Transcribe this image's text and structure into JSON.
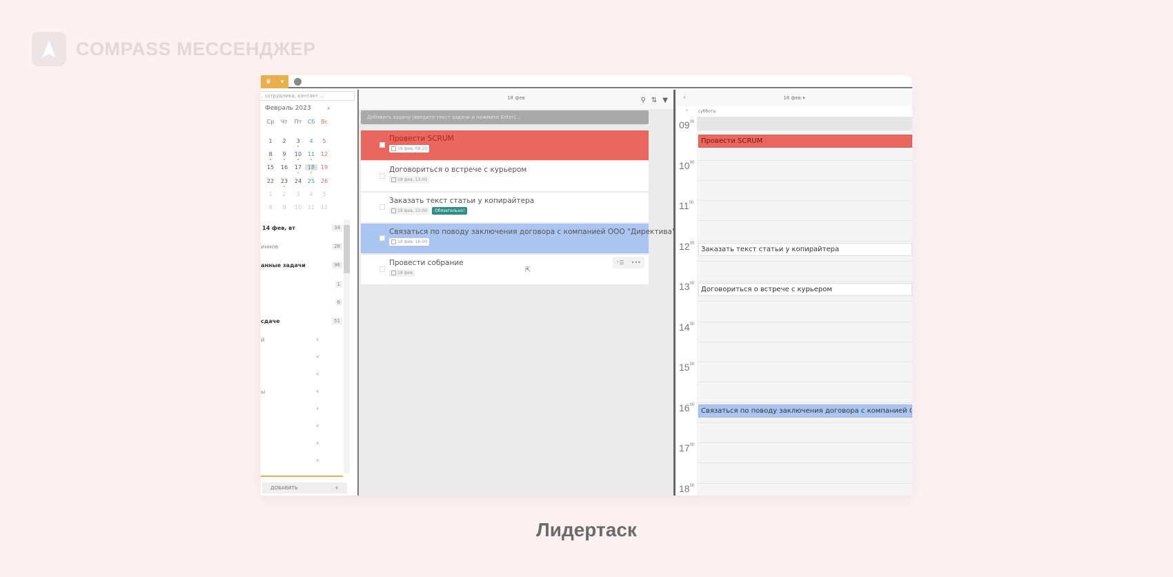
{
  "brand": {
    "name": "COMPASS МЕССЕНДЖЕР"
  },
  "caption": "Лидертаск",
  "sidebar": {
    "search_placeholder": ", сотрудника, контакт ...",
    "month": "Февраль 2023",
    "weekdays": [
      "Ср",
      "Чт",
      "Пт",
      "Сб",
      "Вс"
    ],
    "weeks": [
      [
        "1",
        "2",
        "3",
        "4",
        "5"
      ],
      [
        "8",
        "9",
        "10",
        "11",
        "12"
      ],
      [
        "15",
        "16",
        "17",
        "18",
        "19"
      ],
      [
        "22",
        "23",
        "24",
        "25",
        "26"
      ],
      [
        "1",
        "2",
        "3",
        "4",
        "5"
      ],
      [
        "8",
        "9",
        "10",
        "11",
        "12"
      ]
    ],
    "items": [
      {
        "label": "14 фев, вт",
        "count": "34"
      },
      {
        "label": "инное",
        "count": "28"
      },
      {
        "label": "анные задачи",
        "count": "96"
      },
      {
        "label": "",
        "count": "1"
      },
      {
        "label": "",
        "count": "6"
      },
      {
        "label": "сдаче",
        "count": "51"
      }
    ],
    "groups": [
      "й",
      "",
      "",
      "ы",
      "",
      "",
      "",
      ""
    ],
    "add_label": "ДОБАВИТЬ",
    "add_icon": "+"
  },
  "tasks": {
    "header": "18 фев",
    "add_placeholder": "Добавить задачу (введите текст задачи и нажмите Enter)...",
    "items": [
      {
        "title": "Провести SCRUM",
        "date": "18 фев, 09:20",
        "color": "#e9675f"
      },
      {
        "title": "Договориться о встрече с курьером",
        "date": "18 фев, 13:00"
      },
      {
        "title": "Заказать текст статьи у копирайтера",
        "date": "18 фев, 12:00",
        "badge": "Обязательно!"
      },
      {
        "title": "Связаться по поводу заключения договора с компанией ООО \"Директива\"",
        "date": "18 фев, 16:00",
        "color": "#aac5f0"
      },
      {
        "title": "Провести собрание",
        "date": "18 фев"
      }
    ]
  },
  "calendar": {
    "header": "18 фев ▾",
    "day": "суббота",
    "hours": [
      "09",
      "10",
      "11",
      "12",
      "13",
      "14",
      "15",
      "16",
      "17",
      "18"
    ],
    "minutes": "00",
    "events": [
      {
        "title": "Провести SCRUM",
        "start": 9.33,
        "color": "red"
      },
      {
        "title": "Заказать текст статьи у копирайтера",
        "start": 12
      },
      {
        "title": "Договориться о встрече с курьером",
        "start": 13
      },
      {
        "title": "Связаться по поводу заключения договора с компанией ООО \"Директива\"",
        "start": 16,
        "color": "blue"
      }
    ]
  }
}
